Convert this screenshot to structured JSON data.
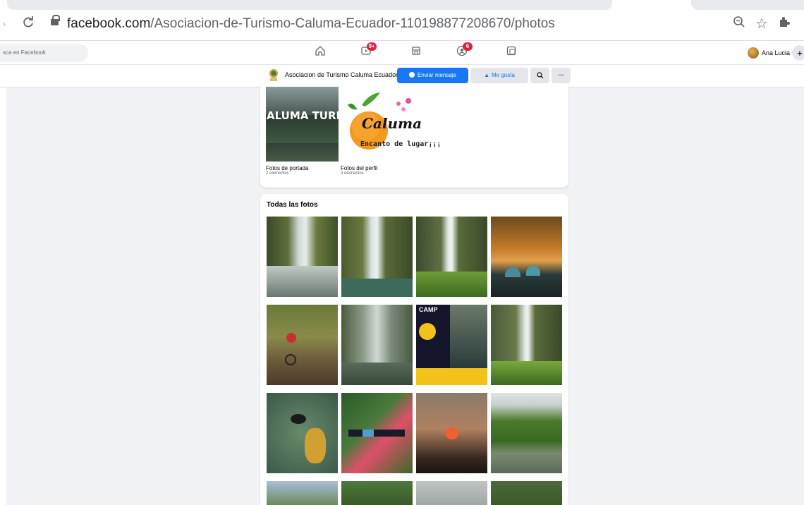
{
  "browser": {
    "url_domain": "facebook.com",
    "url_path": "/Asociacion-de-Turismo-Caluma-Ecuador-110198877208670/photos"
  },
  "topbar": {
    "search_placeholder": "sca en Facebook",
    "nav": [
      {
        "icon": "home-icon"
      },
      {
        "icon": "watch-icon",
        "badge": "9+"
      },
      {
        "icon": "marketplace-icon"
      },
      {
        "icon": "groups-icon",
        "badge": "6"
      },
      {
        "icon": "gaming-icon"
      }
    ],
    "user_name": "Ana Lucia",
    "plus": "+"
  },
  "page_header": {
    "name": "Asociacion de Turismo Caluma Ecuador",
    "message_button": "Enviar mensaje",
    "like_button": "Me gusta",
    "more": "···"
  },
  "albums": [
    {
      "title": "Fotos de portada",
      "count": "2 elementos",
      "cover_text": "ALUMA TURISTIC"
    },
    {
      "title": "Fotos del perfil",
      "count": "3 elementos",
      "cover_text": "Caluma",
      "cover_subtext": "Encanto de lugar¡¡¡"
    }
  ],
  "photos_section": {
    "title": "Todas las fotos",
    "camp_text": "CAMP"
  },
  "colors": {
    "fb_blue": "#1877f2",
    "badge_red": "#e41e3f",
    "page_bg": "#f0f2f5"
  }
}
